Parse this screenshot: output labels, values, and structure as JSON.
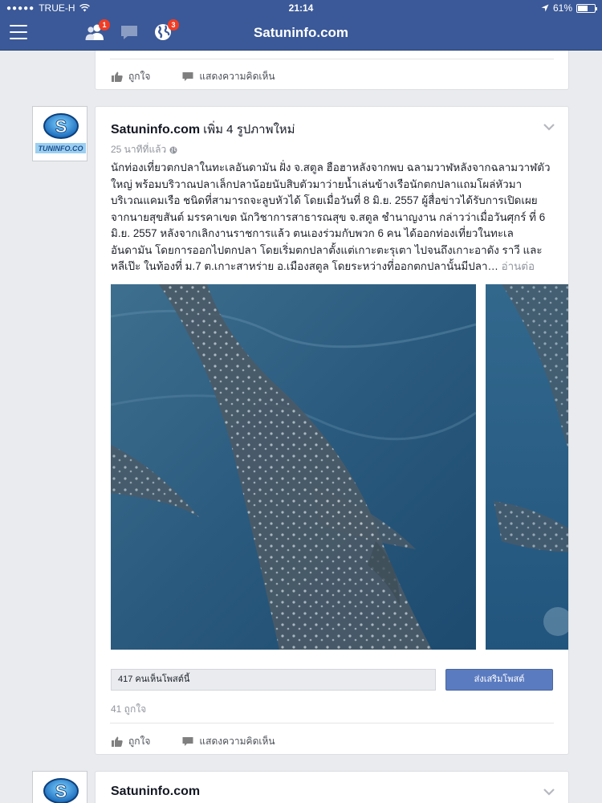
{
  "status_bar": {
    "carrier": "TRUE-H",
    "time": "21:14",
    "battery": "61%",
    "battery_level": 0.61
  },
  "nav": {
    "title": "Satuninfo.com",
    "friend_requests_count": "1",
    "notifications_count": "3",
    "icons": [
      "menu-icon",
      "friend-requests-icon",
      "messages-icon",
      "notifications-globe-icon"
    ]
  },
  "top_card": {
    "like_label": "ถูกใจ",
    "comment_label": "แสดงความคิดเห็น"
  },
  "post": {
    "author": "Satuninfo.com",
    "action_text": "เพิ่ม 4 รูปภาพใหม่",
    "time": "25 นาทีที่แล้ว",
    "text_lines": [
      "นักท่องเที่ยวตกปลาในทะเลอันดามัน ฝั่ง จ.สตูล ฮือฮาหลังจากพบ ฉลามวาฬหลังจากฉลามวาฬตัว",
      "ใหญ่ พร้อมบริวาณปลาเล็กปลาน้อยนับสิบตัวมาว่ายน้ำเล่นข้างเรือนักตกปลาแถมโผล่หัวมา",
      "บริเวณแคมเรือ ชนิดที่สามารถจะลูบหัวได้ โดยเมื่อวันที่ 8 มิ.ย. 2557 ผู้สื่อข่าวได้รับการเปิดเผย",
      "จากนายสุขสันต์ มรรคาเขต นักวิชาการสาธารณสุข จ.สตูล ชำนาญงาน กล่าวว่าเมื่อวันศุกร์ ที่ 6",
      "มิ.ย. 2557 หลังจากเลิกงานราชการแล้ว ตนเองร่วมกับพวก 6 คน ได้ออกท่องเที่ยวในทะเล",
      "อันดามัน โดยการออกไปตกปลา โดยเริ่มตกปลาตั้งแต่เกาะตะรุเตา ไปจนถึงเกาะอาดัง ราวี และ",
      "หลีเป๊ะ ในท้องที่ ม.7 ต.เกาะสาหร่าย อ.เมืองสตูล โดยระหว่างที่ออกตกปลานั้นมีปลา…"
    ],
    "see_more": "อ่านต่อ",
    "reach_text": "417 คนเห็นโพสต์นี้",
    "boost_label": "ส่งเสริมโพสต์",
    "likes_text": "41 ถูกใจ",
    "like_label": "ถูกใจ",
    "comment_label": "แสดงความคิดเห็น"
  },
  "next_post": {
    "author": "Satuninfo.com"
  },
  "colors": {
    "brand": "#3b5998",
    "badge": "#f03d25",
    "boost": "#5b7bc0",
    "background": "#e9ebee"
  }
}
